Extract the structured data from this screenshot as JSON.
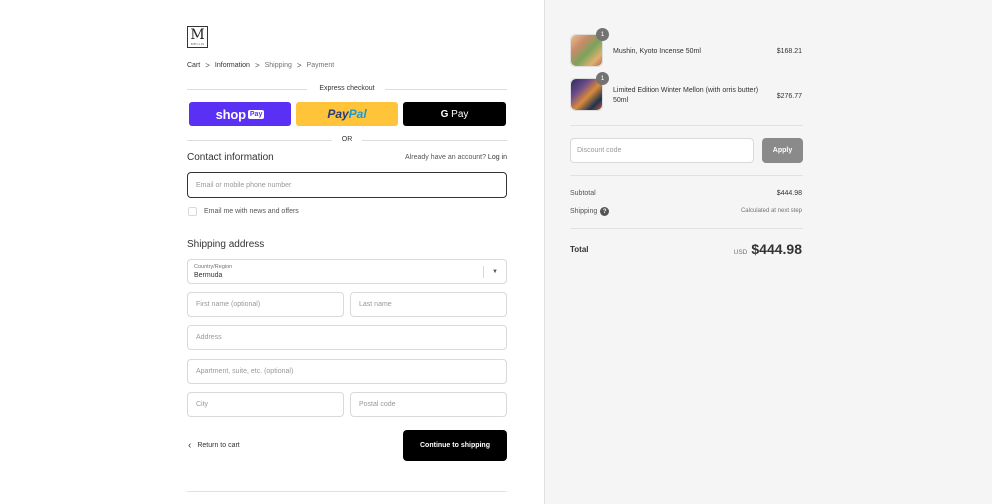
{
  "brand": {
    "logo_letter": "M",
    "logo_sub": "MELLIS"
  },
  "breadcrumb": [
    {
      "label": "Cart",
      "state": "link"
    },
    {
      "label": "Information",
      "state": "current"
    },
    {
      "label": "Shipping",
      "state": "upcoming"
    },
    {
      "label": "Payment",
      "state": "upcoming"
    }
  ],
  "breadcrumb_separator": ">",
  "express": {
    "title": "Express checkout",
    "shop_label": "shop",
    "shop_pay_badge": "Pay",
    "paypal_pay": "Pay",
    "paypal_pal": "Pal",
    "gpay_g": "G",
    "gpay_label": "Pay",
    "or_label": "OR"
  },
  "contact": {
    "heading": "Contact information",
    "account_prompt": "Already have an account?",
    "login_label": "Log in",
    "email_placeholder": "Email or mobile phone number",
    "newsletter_label": "Email me with news and offers"
  },
  "shipping": {
    "heading": "Shipping address",
    "country_label": "Country/Region",
    "country_value": "Bermuda",
    "first_name_placeholder": "First name (optional)",
    "last_name_placeholder": "Last name",
    "address_placeholder": "Address",
    "apartment_placeholder": "Apartment, suite, etc. (optional)",
    "city_placeholder": "City",
    "postal_placeholder": "Postal code"
  },
  "actions": {
    "return_label": "Return to cart",
    "continue_label": "Continue to shipping"
  },
  "cart": {
    "items": [
      {
        "name": "Mushin, Kyoto Incense 50ml",
        "price": "$168.21",
        "quantity": "1"
      },
      {
        "name": "Limited Edition Winter Mellon (with orris butter) 50ml",
        "price": "$276.77",
        "quantity": "1"
      }
    ],
    "discount_placeholder": "Discount code",
    "apply_label": "Apply",
    "subtotal_label": "Subtotal",
    "subtotal_value": "$444.98",
    "shipping_label": "Shipping",
    "shipping_value": "Calculated at next step",
    "total_label": "Total",
    "total_currency": "USD",
    "total_value": "$444.98"
  },
  "colors": {
    "shop_pay": "#5a31f4",
    "paypal": "#ffc439",
    "gpay": "#000000",
    "primary_button": "#000000",
    "apply_button": "#8a8a8a",
    "sidebar_bg": "#f5f5f5"
  }
}
